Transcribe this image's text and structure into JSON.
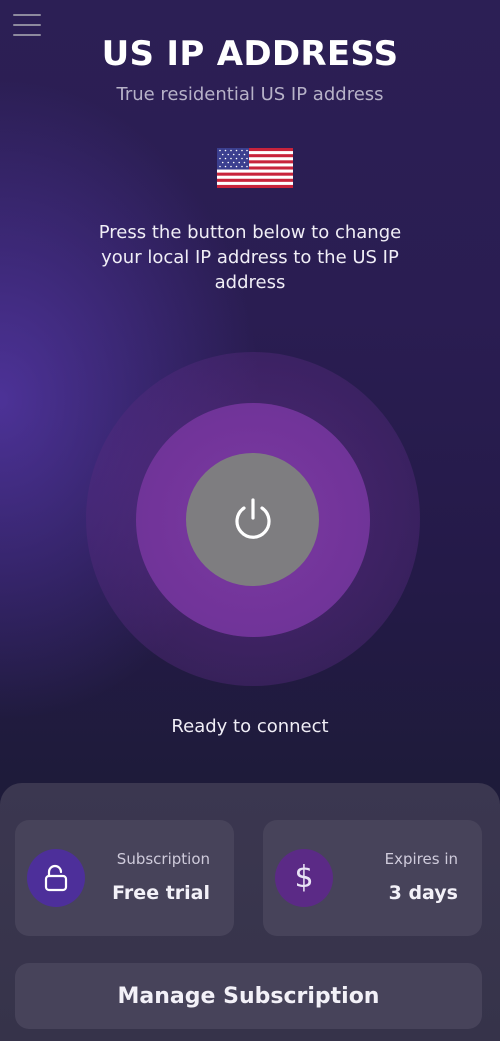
{
  "header": {
    "menu_icon": "hamburger-menu-icon",
    "title": "US IP ADDRESS",
    "subtitle": "True residential US IP address",
    "flag_icon": "us-flag-icon"
  },
  "main": {
    "instructions": "Press the button below to change your local IP address to the US IP address",
    "power_icon": "power-icon",
    "status": "Ready to connect"
  },
  "cards": {
    "subscription": {
      "icon": "unlock-icon",
      "label": "Subscription",
      "value": "Free trial"
    },
    "expires": {
      "icon": "dollar-icon",
      "glyph": "$",
      "label": "Expires in",
      "value": "3 days"
    }
  },
  "footer": {
    "manage_label": "Manage Subscription"
  },
  "colors": {
    "accent_purple": "#4d2f9a",
    "ring_purple": "#7c3aa0",
    "power_button_gray": "#7e7d80",
    "card_bg": "#47435a"
  }
}
